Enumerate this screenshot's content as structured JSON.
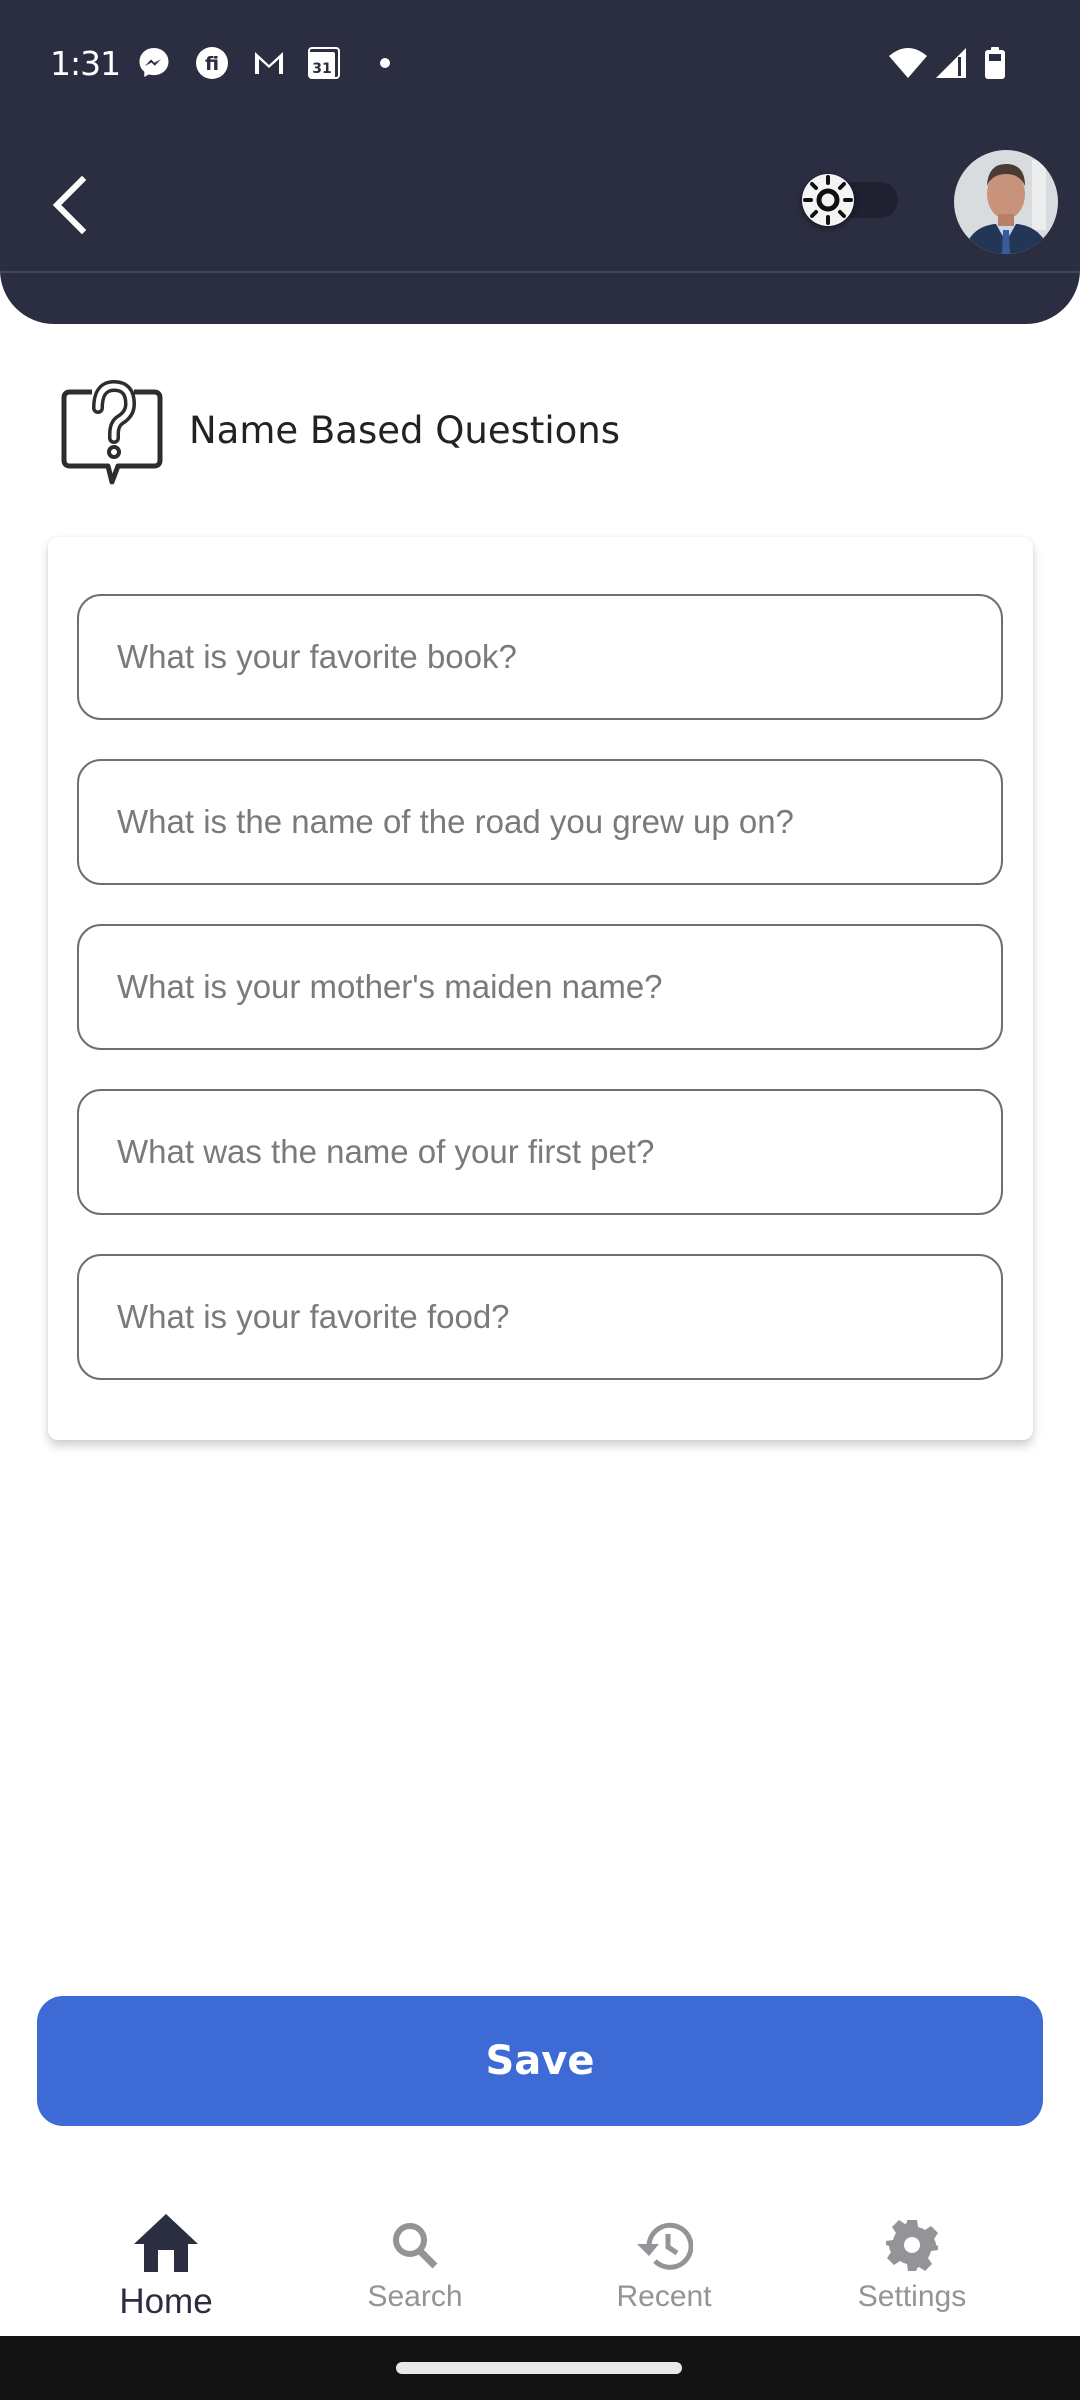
{
  "status_bar": {
    "time": "1:31",
    "notification_icons": [
      "messenger-icon",
      "fi-app-icon",
      "gmail-icon",
      "calendar-icon",
      "more-dot-icon"
    ],
    "calendar_day": "31",
    "system_icons": [
      "wifi-icon",
      "cellular-signal-icon",
      "battery-icon"
    ]
  },
  "header": {
    "back_icon": "chevron-left-icon",
    "theme_toggle": {
      "icon": "sun-icon",
      "state": "off"
    },
    "avatar": "user-profile-photo"
  },
  "section": {
    "icon": "question-speech-bubble-icon",
    "title": "Name Based Questions"
  },
  "questions": [
    {
      "placeholder": "What is your favorite book?",
      "value": ""
    },
    {
      "placeholder": "What is the name of the road you grew up on?",
      "value": ""
    },
    {
      "placeholder": "What is your mother's maiden name?",
      "value": ""
    },
    {
      "placeholder": "What was the name of your first pet?",
      "value": ""
    },
    {
      "placeholder": "What is your favorite food?",
      "value": ""
    }
  ],
  "save_button": {
    "label": "Save",
    "color": "#3d6ad4"
  },
  "bottom_nav": {
    "active": "Home",
    "items": [
      {
        "label": "Home",
        "icon": "home-icon"
      },
      {
        "label": "Search",
        "icon": "search-icon"
      },
      {
        "label": "Recent",
        "icon": "history-icon"
      },
      {
        "label": "Settings",
        "icon": "gear-icon"
      }
    ]
  },
  "colors": {
    "header_bg": "#2b2d41",
    "accent": "#3d6ad4",
    "nav_active": "#2b2d41",
    "nav_inactive": "#949498"
  }
}
